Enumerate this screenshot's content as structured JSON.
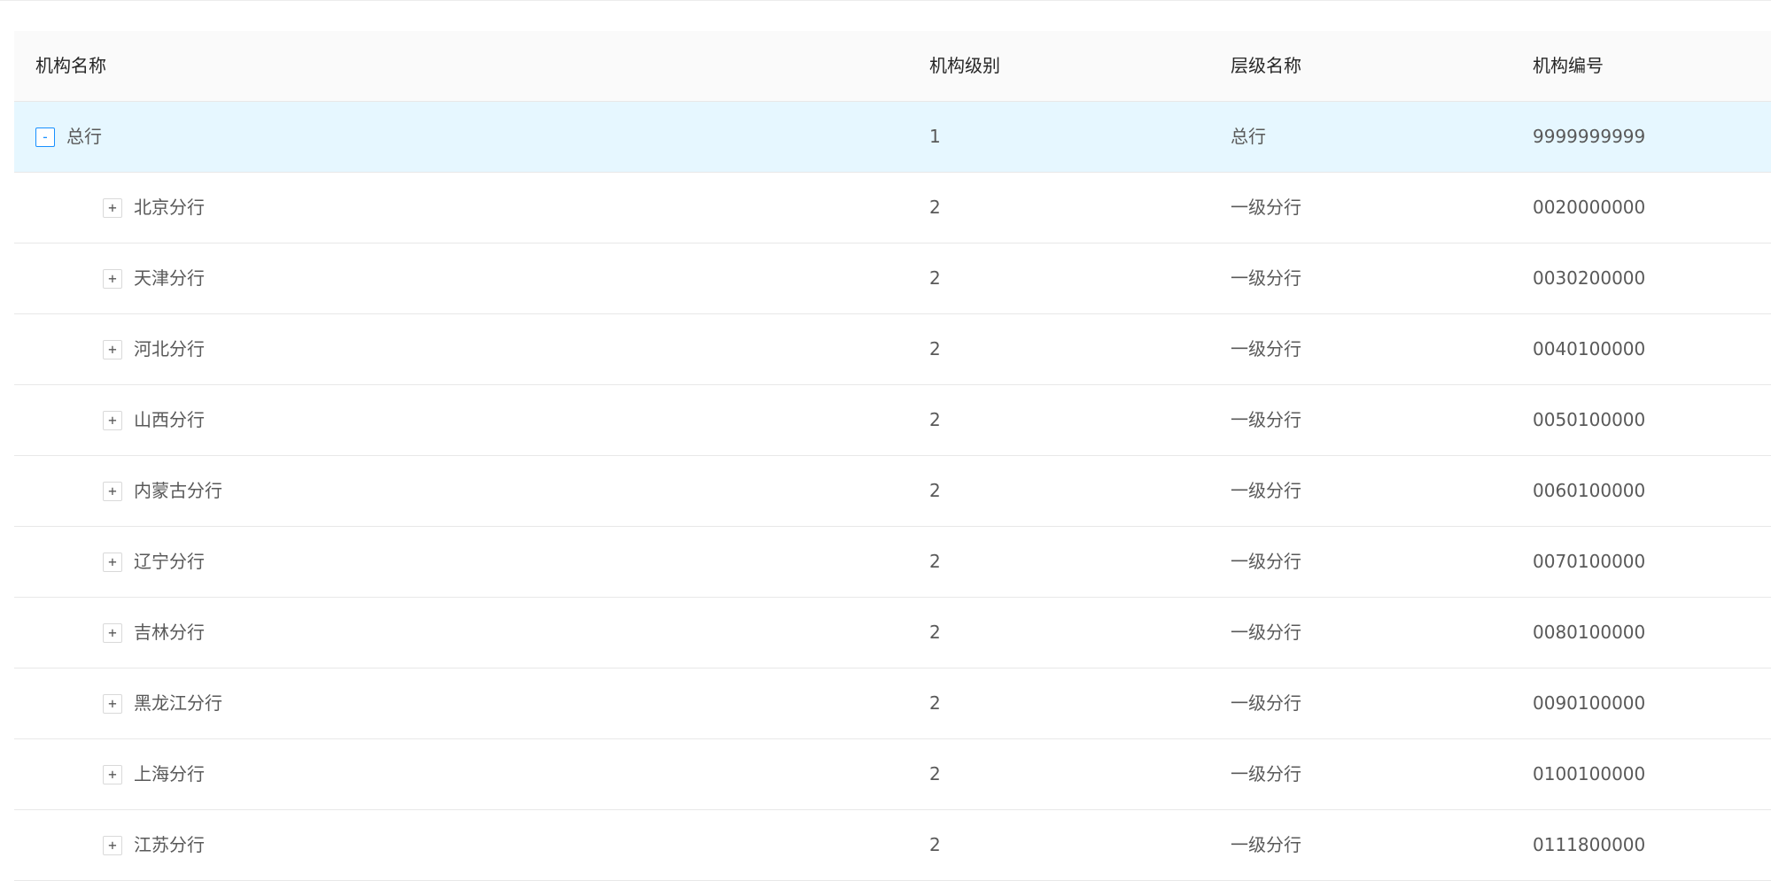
{
  "table": {
    "columns": [
      "机构名称",
      "机构级别",
      "层级名称",
      "机构编号"
    ],
    "rows": [
      {
        "toggle": "-",
        "name": "总行",
        "level": "1",
        "tier": "总行",
        "code": "9999999999"
      },
      {
        "toggle": "+",
        "name": "北京分行",
        "level": "2",
        "tier": "一级分行",
        "code": "0020000000"
      },
      {
        "toggle": "+",
        "name": "天津分行",
        "level": "2",
        "tier": "一级分行",
        "code": "0030200000"
      },
      {
        "toggle": "+",
        "name": "河北分行",
        "level": "2",
        "tier": "一级分行",
        "code": "0040100000"
      },
      {
        "toggle": "+",
        "name": "山西分行",
        "level": "2",
        "tier": "一级分行",
        "code": "0050100000"
      },
      {
        "toggle": "+",
        "name": "内蒙古分行",
        "level": "2",
        "tier": "一级分行",
        "code": "0060100000"
      },
      {
        "toggle": "+",
        "name": "辽宁分行",
        "level": "2",
        "tier": "一级分行",
        "code": "0070100000"
      },
      {
        "toggle": "+",
        "name": "吉林分行",
        "level": "2",
        "tier": "一级分行",
        "code": "0080100000"
      },
      {
        "toggle": "+",
        "name": "黑龙江分行",
        "level": "2",
        "tier": "一级分行",
        "code": "0090100000"
      },
      {
        "toggle": "+",
        "name": "上海分行",
        "level": "2",
        "tier": "一级分行",
        "code": "0100100000"
      },
      {
        "toggle": "+",
        "name": "江苏分行",
        "level": "2",
        "tier": "一级分行",
        "code": "0111800000"
      }
    ]
  }
}
